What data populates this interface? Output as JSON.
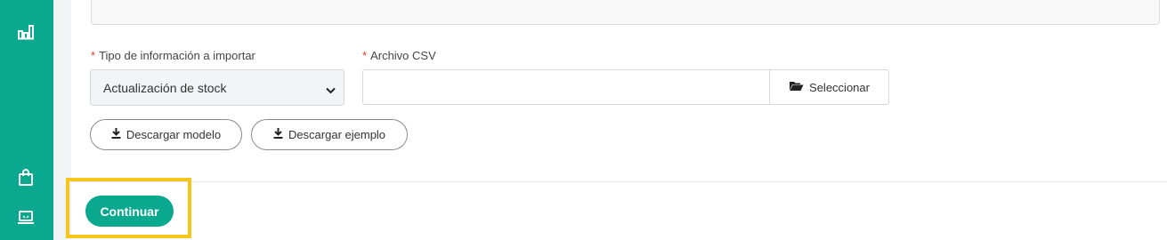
{
  "sidebar": {
    "items": [
      {
        "icon": "bar-chart-icon"
      },
      {
        "icon": "shopping-bag-icon"
      },
      {
        "icon": "laptop-icon"
      }
    ]
  },
  "form": {
    "import_type": {
      "label": "Tipo de información a importar",
      "required_mark": "*",
      "selected": "Actualización de stock"
    },
    "csv_file": {
      "label": "Archivo CSV",
      "required_mark": "*",
      "value": "",
      "button_label": "Seleccionar",
      "button_icon": "folder-open-icon"
    },
    "download_model_label": "Descargar modelo",
    "download_example_label": "Descargar ejemplo"
  },
  "footer": {
    "continue_label": "Continuar"
  },
  "colors": {
    "sidebar": "#0ba890",
    "primary": "#0ba890",
    "highlight": "#f6c71a",
    "required": "#e53935"
  }
}
